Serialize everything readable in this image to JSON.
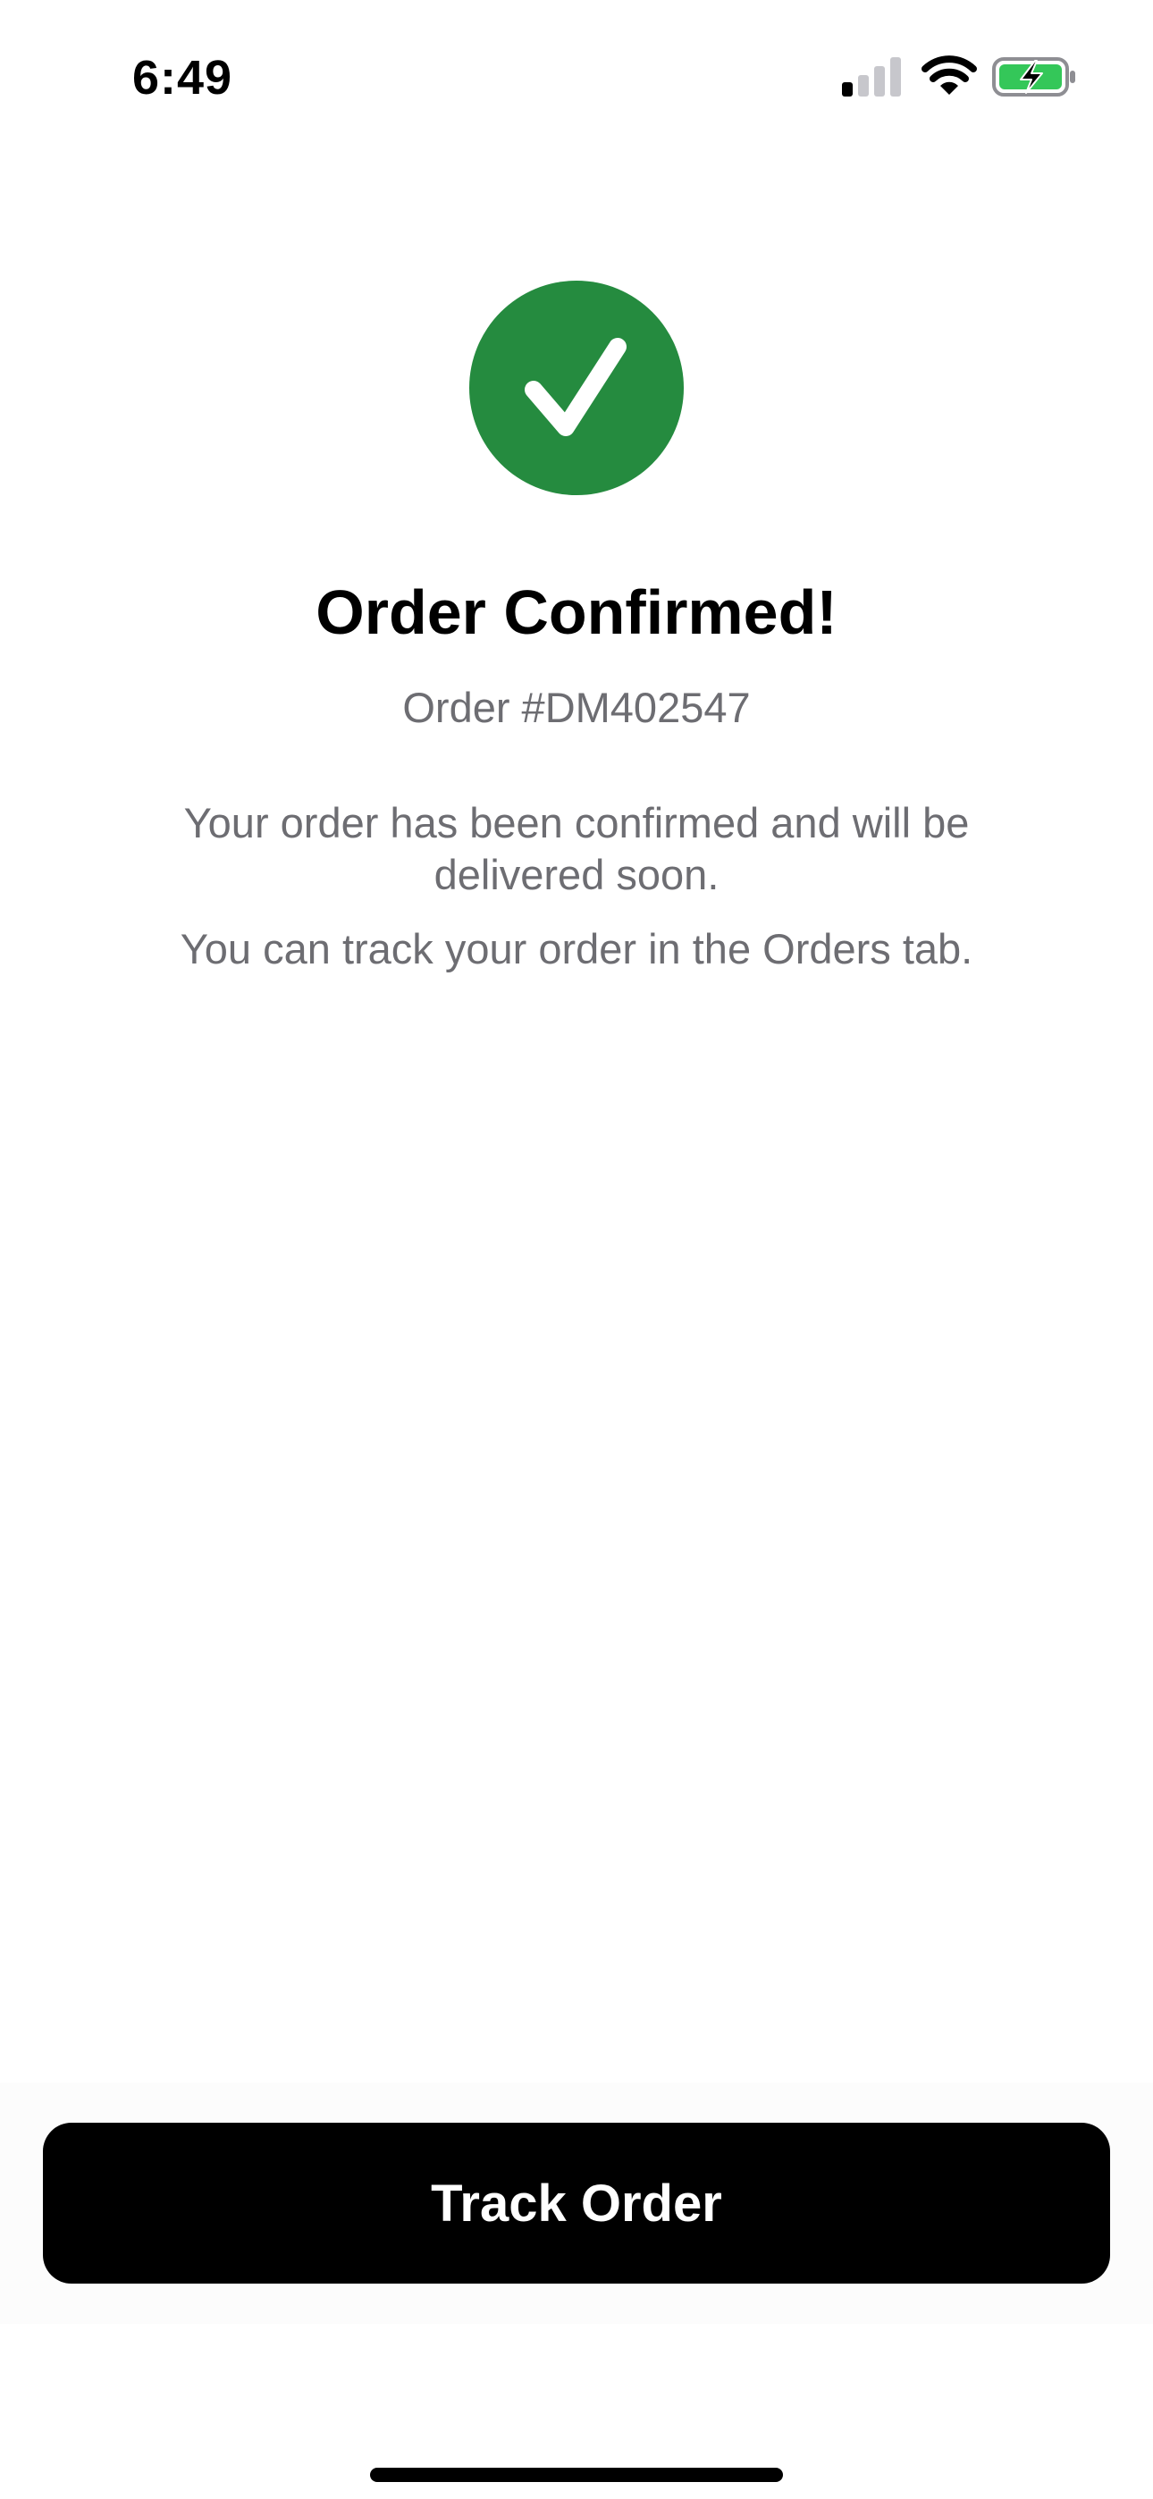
{
  "status_bar": {
    "time": "6:49",
    "signal_icon": "cellular-signal-icon",
    "wifi_icon": "wifi-icon",
    "battery_icon": "battery-charging-icon",
    "battery_color": "#34c759"
  },
  "confirmation": {
    "icon": "checkmark-icon",
    "icon_color": "#258b3f",
    "title": "Order Confirmed!",
    "order_number": "Order #DM402547",
    "message": "Your order has been confirmed and will be delivered soon.",
    "tracking_hint": "You can track your order in the Orders tab."
  },
  "actions": {
    "track_order_label": "Track Order"
  }
}
